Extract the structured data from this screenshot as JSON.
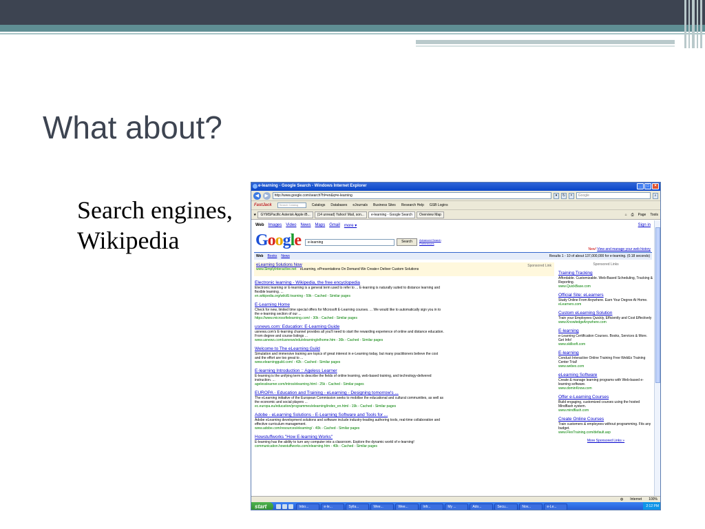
{
  "slide": {
    "title": "What about?",
    "body": "Search engines, Wikipedia"
  },
  "browser": {
    "window_title": "e-learning - Google Search - Windows Internet Explorer",
    "address": "http://www.google.com/search?hl=en&q=e-learning",
    "search_placeholder": "Google",
    "links_bar": {
      "brand": "FastJack",
      "search_placeholder": "Search Catalog",
      "items": [
        "Catalogs",
        "Databases",
        "eJournals",
        "Business Sites",
        "Research Help",
        "GSB Logins"
      ]
    },
    "tabs": [
      "GYMSPacific Asterisk Apple iB...",
      "(14 unread) Yahoo! Mail, son...",
      "e-learning - Google Search",
      "Overview Map"
    ],
    "tools": {
      "page": "Page",
      "tools": "Tools"
    }
  },
  "google": {
    "nav": [
      "Web",
      "Images",
      "Video",
      "News",
      "Maps",
      "Gmail",
      "more ▾"
    ],
    "signin": "Sign in",
    "query": "e-learning",
    "search_button": "Search",
    "advanced": "Advanced Search",
    "preferences": "Preferences",
    "new_label": "New!",
    "new_text": "View and manage your web history",
    "result_tabs": [
      "Web",
      "Books",
      "News"
    ],
    "results_stat": "Results 1 - 10 of about 137,000,000 for e-learning. (0.18 seconds)",
    "sponsored_top": {
      "title": "eLearning Solutions Now",
      "url": "www.SimplyInteractive.net",
      "text": "eLearning, ePresentations On Demand We Create+ Deliver Custom Solutions",
      "label": "Sponsored Link"
    },
    "results": [
      {
        "title": "Electronic learning - Wikipedia, the free encyclopedia",
        "snippet": "Electronic learning or E-learning is a general term used to refer to ... E-learning is naturally suited to distance learning and flexible learning. ...",
        "url": "en.wikipedia.org/wiki/E-learning - 59k - Cached - Similar pages"
      },
      {
        "title": "E-Learning Home",
        "snippet": "Check for new, limited time special offers for Microsoft E-Learning courses. ... We would like to automatically sign you in to the e-learning section of our ...",
        "url": "https://www.microsoftelearning.com/ - 30k - Cached - Similar pages"
      },
      {
        "title": "usnews.com: Education: E-Learning Guide",
        "snippet": "usnews.com's E-learning channel provides all you'll need to start the rewarding experience of online and distance education. From degree and course listings ...",
        "url": "www.usnews.com/usnews/edu/elearning/elhome.htm - 36k - Cached - Similar pages"
      },
      {
        "title": "Welcome to The eLearning Guild",
        "snippet": "Simulation and immersive training are topics of great interest in e-Learning today, but many practitioners believe the cost and the effort are too great to ...",
        "url": "www.elearningguild.com/ - 42k - Cached - Similar pages"
      },
      {
        "title": "E-learning Introduction :: Ageless Learner",
        "snippet": "E-learning is the unifying term to describe the fields of online learning, web-based training, and technology-delivered instruction. ...",
        "url": "agelesslearner.com/intros/elearning.html - 25k - Cached - Similar pages"
      },
      {
        "title": "EUROPA - Education and Training - eLearning - Designing tomorrow's ...",
        "snippet": "The eLearning initiative of the European Commission seeks to mobilise the educational and cultural communities, as well as the economic and social players ...",
        "url": "ec.europa.eu/education/programmes/elearning/index_en.html - 19k - Cached - Similar pages"
      },
      {
        "title": "Adobe - eLearning Solutions - E-Learning Software and Tools for ...",
        "snippet": "Adobe eLearning development solutions and software include industry-leading authoring tools, real-time collaboration and effective curriculum management.",
        "url": "www.adobe.com/resources/elearning/ - 40k - Cached - Similar pages"
      },
      {
        "title": "Howstuffworks \"How E-learning Works\"",
        "snippet": "E-learning has the ability to turn any computer into a classroom. Explore the dynamic world of e-learning!",
        "url": "communication.howstuffworks.com/elearning.htm - 40k - Cached - Similar pages"
      }
    ],
    "sponsored_side_label": "Sponsored Links",
    "ads": [
      {
        "title": "Training Tracking",
        "text": "Affordable. Customizable. Web-Based Scheduling, Tracking & Reporting.",
        "url": "www.QuickBase.com"
      },
      {
        "title": "Official Site: eLearners",
        "text": "Study Online From Anywhere. Earn Your Degree At Home.",
        "url": "eLearners.com"
      },
      {
        "title": "Custom eLearning Solution",
        "text": "Train your Employees Quickly, Efficiently and Cost Effectively",
        "url": "www.KnowledgeAnywhere.com"
      },
      {
        "title": "E-learning",
        "text": "e-Learning Certification Courses. Books, Services & More. Get Info!",
        "url": "www.skillsoft.com"
      },
      {
        "title": "E-learning",
        "text": "Conduct Interactive Online Training Free WebEx Training Center Trial!",
        "url": "www.webex.com"
      },
      {
        "title": "eLearning Software",
        "text": "Create & manage learning programs with Web-based e-learning software.",
        "url": "www.dominKnow.com"
      },
      {
        "title": "Offer e-Learning Courses",
        "text": "Build engaging, customized courses using the hosted Mindflash system.",
        "url": "www.mindflash.com"
      },
      {
        "title": "Create Online Courses",
        "text": "Train customers & employees without programming. Fits any budget.",
        "url": "www.FlexTraining.com/default.asp"
      }
    ],
    "more_sponsored": "More Sponsored Links »"
  },
  "status": {
    "zone": "Internet",
    "zoom": "100%"
  },
  "taskbar": {
    "start": "start",
    "tasks": [
      "Inbo...",
      "e-le...",
      "Sylla...",
      "Wee...",
      "Wee...",
      "Infr...",
      "My ...",
      "Ado...",
      "Secu...",
      "Nov...",
      "e-Le..."
    ],
    "clock": "2:12 PM"
  }
}
